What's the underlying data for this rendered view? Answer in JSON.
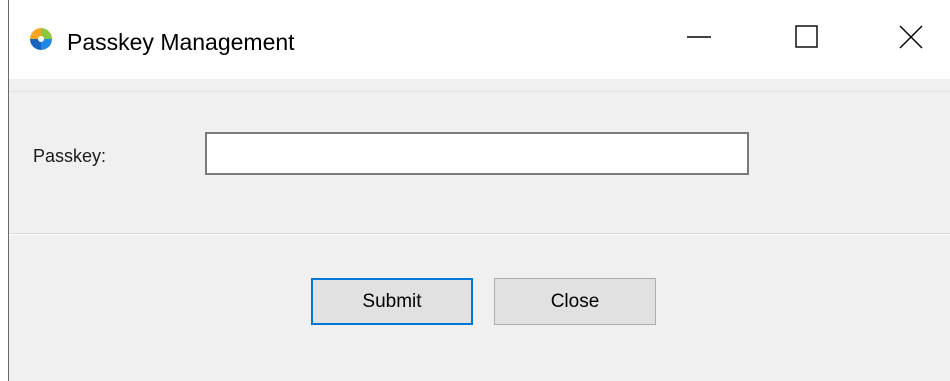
{
  "window": {
    "title": "Passkey Management",
    "app_icon": "app-logo-icon",
    "controls": {
      "minimize_icon": "minimize-icon",
      "maximize_icon": "maximize-icon",
      "close_icon": "close-icon"
    }
  },
  "form": {
    "passkey_label": "Passkey:",
    "passkey_value": ""
  },
  "buttons": {
    "submit_label": "Submit",
    "close_label": "Close"
  },
  "colors": {
    "title_bar": "#ffffff",
    "dialog_background": "#f0f0f0",
    "focused_button_border": "#0078d7",
    "button_background": "#e1e1e1"
  }
}
